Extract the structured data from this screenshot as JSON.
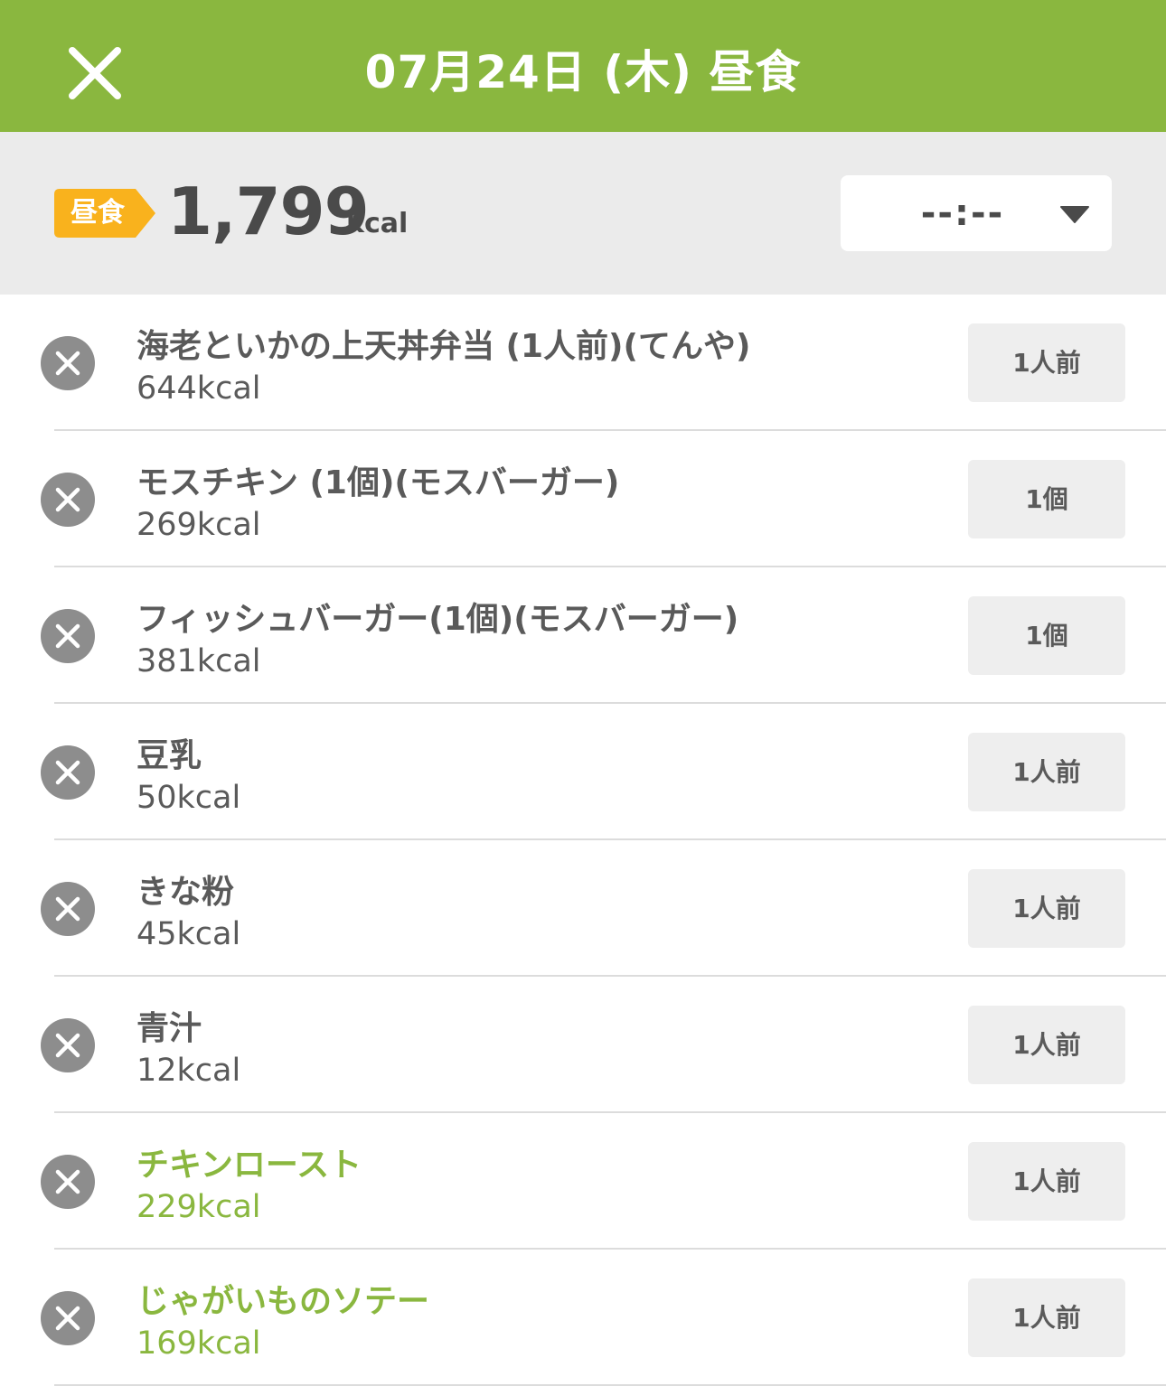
{
  "header": {
    "title": "07月24日 (木) 昼食",
    "close_icon": "close-icon"
  },
  "summary": {
    "meal_badge": "昼食",
    "badge_color": "#f9b21d",
    "total_kcal": "1,799",
    "kcal_unit": "kcal",
    "time_value": "--:--",
    "time_dropdown_icon": "caret-down-icon"
  },
  "colors": {
    "header_bg": "#8ab73f",
    "accent_green": "#8ab73f",
    "summary_bg": "#ebebeb",
    "text_dark": "#5a5a5a",
    "remove_button": "#8d8d8d"
  },
  "food_items": [
    {
      "name": "海老といかの上天丼弁当 (1人前)(てんや)",
      "kcal": "644kcal",
      "qty": "1人前",
      "custom": false
    },
    {
      "name": "モスチキン (1個)(モスバーガー)",
      "kcal": "269kcal",
      "qty": "1個",
      "custom": false
    },
    {
      "name": "フィッシュバーガー(1個)(モスバーガー)",
      "kcal": "381kcal",
      "qty": "1個",
      "custom": false
    },
    {
      "name": "豆乳",
      "kcal": "50kcal",
      "qty": "1人前",
      "custom": false
    },
    {
      "name": "きな粉",
      "kcal": "45kcal",
      "qty": "1人前",
      "custom": false
    },
    {
      "name": "青汁",
      "kcal": "12kcal",
      "qty": "1人前",
      "custom": false
    },
    {
      "name": "チキンロースト",
      "kcal": "229kcal",
      "qty": "1人前",
      "custom": true
    },
    {
      "name": "じゃがいものソテー",
      "kcal": "169kcal",
      "qty": "1人前",
      "custom": true
    }
  ]
}
